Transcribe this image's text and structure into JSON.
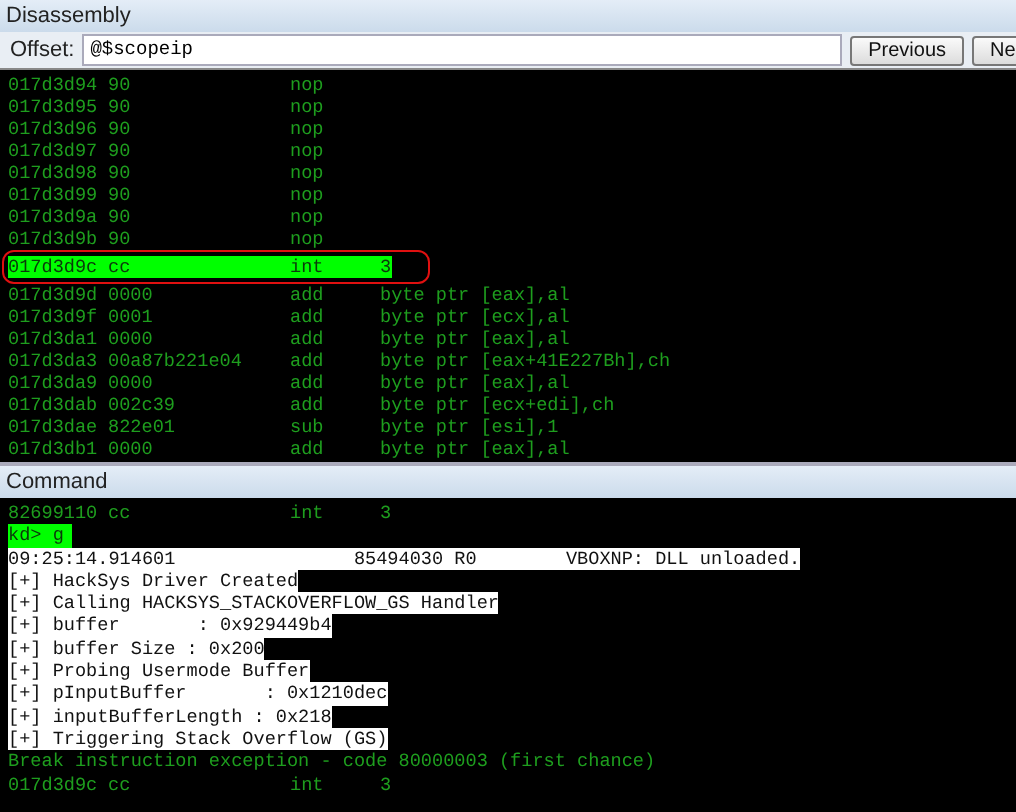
{
  "disassembly": {
    "title": "Disassembly",
    "offset_label": "Offset:",
    "offset_value": "@$scopeip",
    "buttons": [
      "Previous",
      "Ne"
    ],
    "rows": [
      {
        "address": "017d3d94",
        "bytes": "90",
        "mnemonic": "nop",
        "operands": "",
        "selected": false
      },
      {
        "address": "017d3d95",
        "bytes": "90",
        "mnemonic": "nop",
        "operands": "",
        "selected": false
      },
      {
        "address": "017d3d96",
        "bytes": "90",
        "mnemonic": "nop",
        "operands": "",
        "selected": false
      },
      {
        "address": "017d3d97",
        "bytes": "90",
        "mnemonic": "nop",
        "operands": "",
        "selected": false
      },
      {
        "address": "017d3d98",
        "bytes": "90",
        "mnemonic": "nop",
        "operands": "",
        "selected": false
      },
      {
        "address": "017d3d99",
        "bytes": "90",
        "mnemonic": "nop",
        "operands": "",
        "selected": false
      },
      {
        "address": "017d3d9a",
        "bytes": "90",
        "mnemonic": "nop",
        "operands": "",
        "selected": false
      },
      {
        "address": "017d3d9b",
        "bytes": "90",
        "mnemonic": "nop",
        "operands": "",
        "selected": false
      },
      {
        "address": "017d3d9c",
        "bytes": "cc",
        "mnemonic": "int",
        "operands": "3",
        "selected": true
      },
      {
        "address": "017d3d9d",
        "bytes": "0000",
        "mnemonic": "add",
        "operands": "byte ptr [eax],al",
        "selected": false
      },
      {
        "address": "017d3d9f",
        "bytes": "0001",
        "mnemonic": "add",
        "operands": "byte ptr [ecx],al",
        "selected": false
      },
      {
        "address": "017d3da1",
        "bytes": "0000",
        "mnemonic": "add",
        "operands": "byte ptr [eax],al",
        "selected": false
      },
      {
        "address": "017d3da3",
        "bytes": "00a87b221e04",
        "mnemonic": "add",
        "operands": "byte ptr [eax+41E227Bh],ch",
        "selected": false
      },
      {
        "address": "017d3da9",
        "bytes": "0000",
        "mnemonic": "add",
        "operands": "byte ptr [eax],al",
        "selected": false
      },
      {
        "address": "017d3dab",
        "bytes": "002c39",
        "mnemonic": "add",
        "operands": "byte ptr [ecx+edi],ch",
        "selected": false
      },
      {
        "address": "017d3dae",
        "bytes": "822e01",
        "mnemonic": "sub",
        "operands": "byte ptr [esi],1",
        "selected": false
      },
      {
        "address": "017d3db1",
        "bytes": "0000",
        "mnemonic": "add",
        "operands": "byte ptr [eax],al",
        "selected": false
      }
    ]
  },
  "command": {
    "title": "Command",
    "lines": [
      {
        "kind": "instruction",
        "address": "82699110",
        "bytes": "cc",
        "mnemonic": "int",
        "operands": "3"
      },
      {
        "kind": "prompt",
        "text": "kd> g"
      },
      {
        "kind": "output",
        "text": "09:25:14.914601                85494030 R0        VBOXNP: DLL unloaded."
      },
      {
        "kind": "output",
        "text": "[+] HackSys Driver Created"
      },
      {
        "kind": "output",
        "text": "[+] Calling HACKSYS_STACKOVERFLOW_GS Handler"
      },
      {
        "kind": "output",
        "text": "[+] buffer       : 0x929449b4"
      },
      {
        "kind": "output",
        "text": "[+] buffer Size : 0x200"
      },
      {
        "kind": "output",
        "text": "[+] Probing Usermode Buffer"
      },
      {
        "kind": "output",
        "text": "[+] pInputBuffer       : 0x1210dec"
      },
      {
        "kind": "output",
        "text": "[+] inputBufferLength : 0x218"
      },
      {
        "kind": "output",
        "text": "[+] Triggering Stack Overflow (GS)"
      },
      {
        "kind": "message",
        "text": "Break instruction exception - code 80000003 (first chance)"
      },
      {
        "kind": "instruction",
        "address": "017d3d9c",
        "bytes": "cc",
        "mnemonic": "int",
        "operands": "3"
      }
    ]
  }
}
